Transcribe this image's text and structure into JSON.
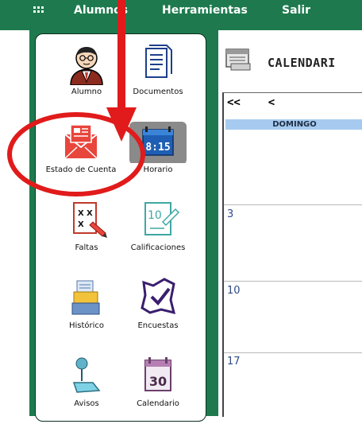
{
  "menu": {
    "items": [
      {
        "label": "Alumnos"
      },
      {
        "label": "Herramientas"
      },
      {
        "label": "Salir"
      }
    ]
  },
  "sidebar": {
    "tiles": [
      {
        "label": "Alumno",
        "icon": "student-avatar-icon"
      },
      {
        "label": "Documentos",
        "icon": "documents-icon"
      },
      {
        "label": "Estado de Cuenta",
        "icon": "envelope-statement-icon"
      },
      {
        "label": "Horario",
        "icon": "schedule-clock-icon"
      },
      {
        "label": "Faltas",
        "icon": "absences-icon"
      },
      {
        "label": "Calificaciones",
        "icon": "grades-icon"
      },
      {
        "label": "Histórico",
        "icon": "history-archive-icon"
      },
      {
        "label": "Encuestas",
        "icon": "survey-checklist-icon"
      },
      {
        "label": "Avisos",
        "icon": "notice-pin-icon"
      },
      {
        "label": "Calendario",
        "icon": "calendar-icon"
      }
    ]
  },
  "calendar": {
    "title": "CALENDARI",
    "nav_prev_year": "<<",
    "nav_prev": "<",
    "weekday": "DOMINGO",
    "days": [
      "3",
      "10",
      "17"
    ],
    "clock_text": "8:15",
    "calendar_icon_number": "30"
  },
  "colors": {
    "brand_green": "#1e7a4e",
    "annotation_red": "#e11b1b",
    "day_header_blue": "#a7cbf0"
  }
}
